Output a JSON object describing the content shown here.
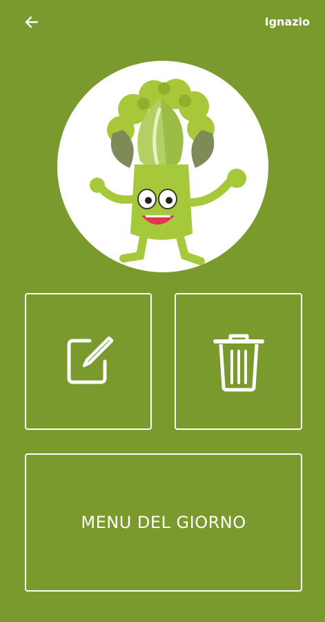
{
  "header": {
    "back_icon": "arrow-left-icon",
    "user_name": "Ignazio"
  },
  "avatar": {
    "icon": "broccoli-mascot-illustration"
  },
  "actions": {
    "edit_icon": "edit-icon",
    "delete_icon": "trash-icon",
    "menu_label": "MENU DEL GIORNO"
  },
  "colors": {
    "background": "#7a9a2e",
    "foreground": "#ffffff"
  }
}
